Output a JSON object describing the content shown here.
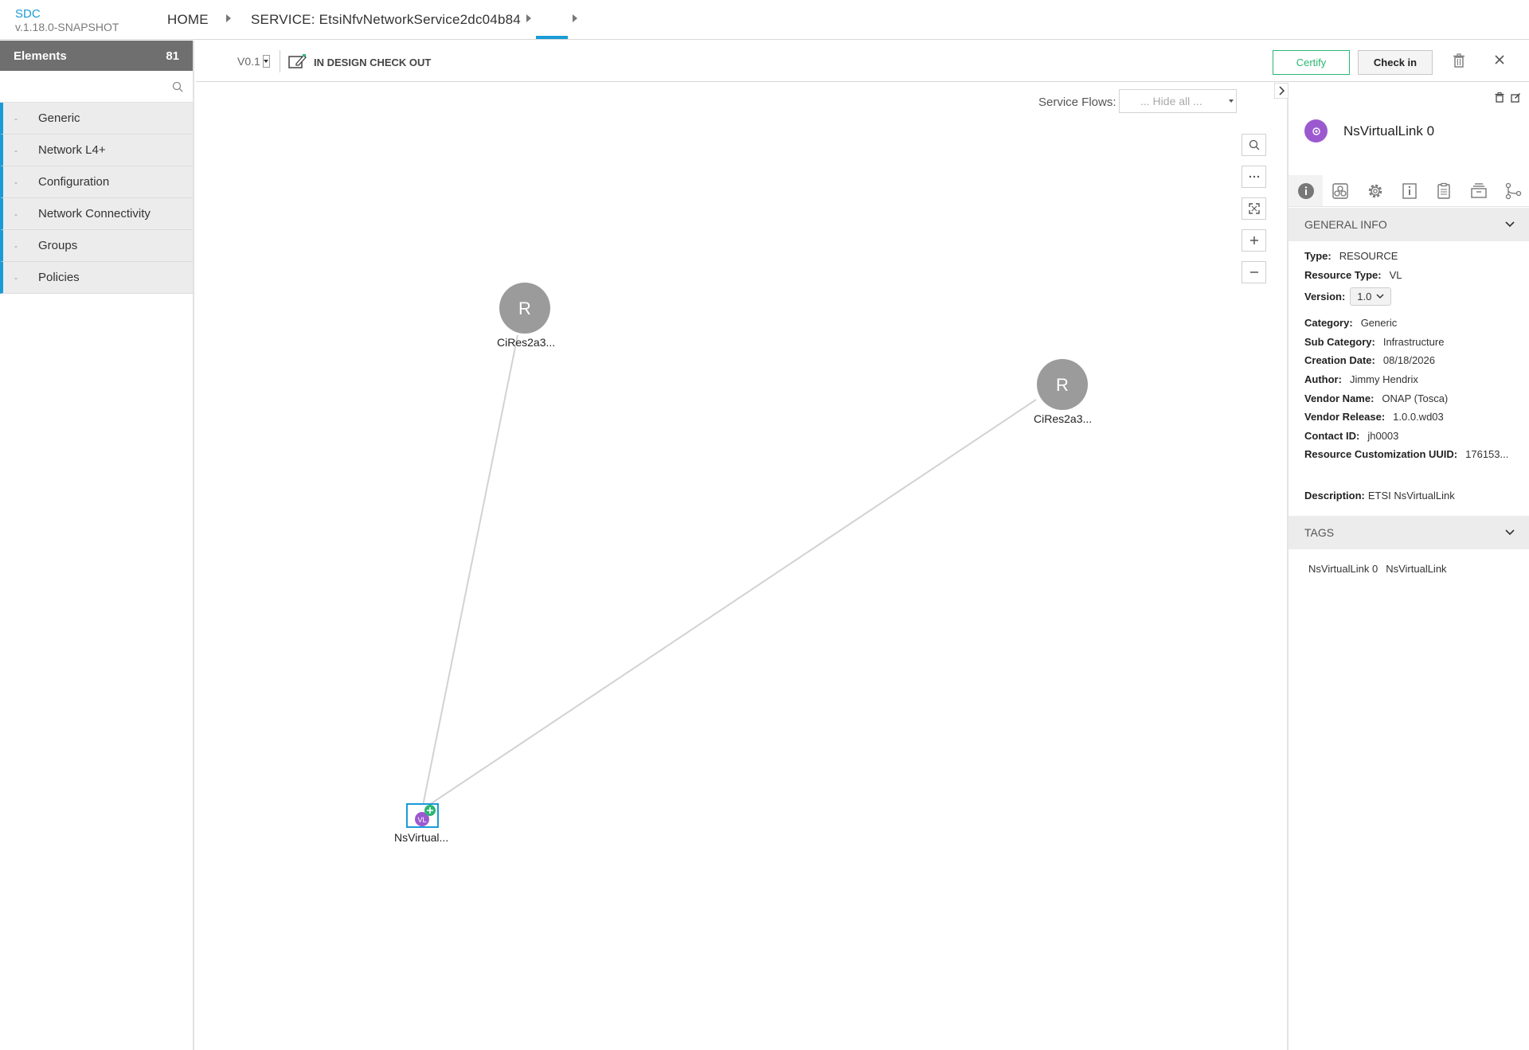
{
  "header": {
    "app_name": "SDC",
    "app_version": "v.1.18.0-SNAPSHOT",
    "breadcrumbs": [
      "HOME",
      "SERVICE: EtsiNfvNetworkService2dc04b84",
      ""
    ]
  },
  "palette": {
    "title": "Elements",
    "count": "81",
    "search_placeholder": "",
    "items": [
      {
        "label": "Generic"
      },
      {
        "label": "Network L4+"
      },
      {
        "label": "Configuration"
      },
      {
        "label": "Network Connectivity"
      },
      {
        "label": "Groups"
      },
      {
        "label": "Policies"
      }
    ]
  },
  "toolbar": {
    "version": "V0.1",
    "status": "IN DESIGN CHECK OUT",
    "certify_label": "Certify",
    "checkin_label": "Check in"
  },
  "canvas": {
    "service_flows_label": "Service Flows:",
    "service_flows_value": "... Hide all ...",
    "nodes": [
      {
        "letter": "R",
        "label": "CiRes2a3..."
      },
      {
        "letter": "R",
        "label": "CiRes2a3..."
      },
      {
        "letter": "VL",
        "label": "NsVirtual..."
      }
    ]
  },
  "sidepanel": {
    "title": "NsVirtualLink 0",
    "general_info_title": "GENERAL INFO",
    "info": {
      "type_label": "Type:",
      "type": "RESOURCE",
      "resource_type_label": "Resource Type:",
      "resource_type": "VL",
      "version_label": "Version:",
      "version": "1.0",
      "category_label": "Category:",
      "category": "Generic",
      "sub_category_label": "Sub Category:",
      "sub_category": "Infrastructure",
      "creation_date_label": "Creation Date:",
      "creation_date": "08/18/2026",
      "author_label": "Author:",
      "author": "Jimmy Hendrix",
      "vendor_name_label": "Vendor Name:",
      "vendor_name": "ONAP (Tosca)",
      "vendor_release_label": "Vendor Release:",
      "vendor_release": "1.0.0.wd03",
      "contact_id_label": "Contact ID:",
      "contact_id": "jh0003",
      "uuid_label": "Resource Customization UUID:",
      "uuid": "176153...",
      "description_label": "Description:",
      "description": "ETSI NsVirtualLink"
    },
    "tags_title": "TAGS",
    "tags": [
      "NsVirtualLink 0",
      "NsVirtualLink"
    ]
  },
  "colors": {
    "accent": "#1a9bd7",
    "certify": "#2bb673",
    "node_gray": "#9b9b9b",
    "vl_purple": "#9b59d0"
  }
}
